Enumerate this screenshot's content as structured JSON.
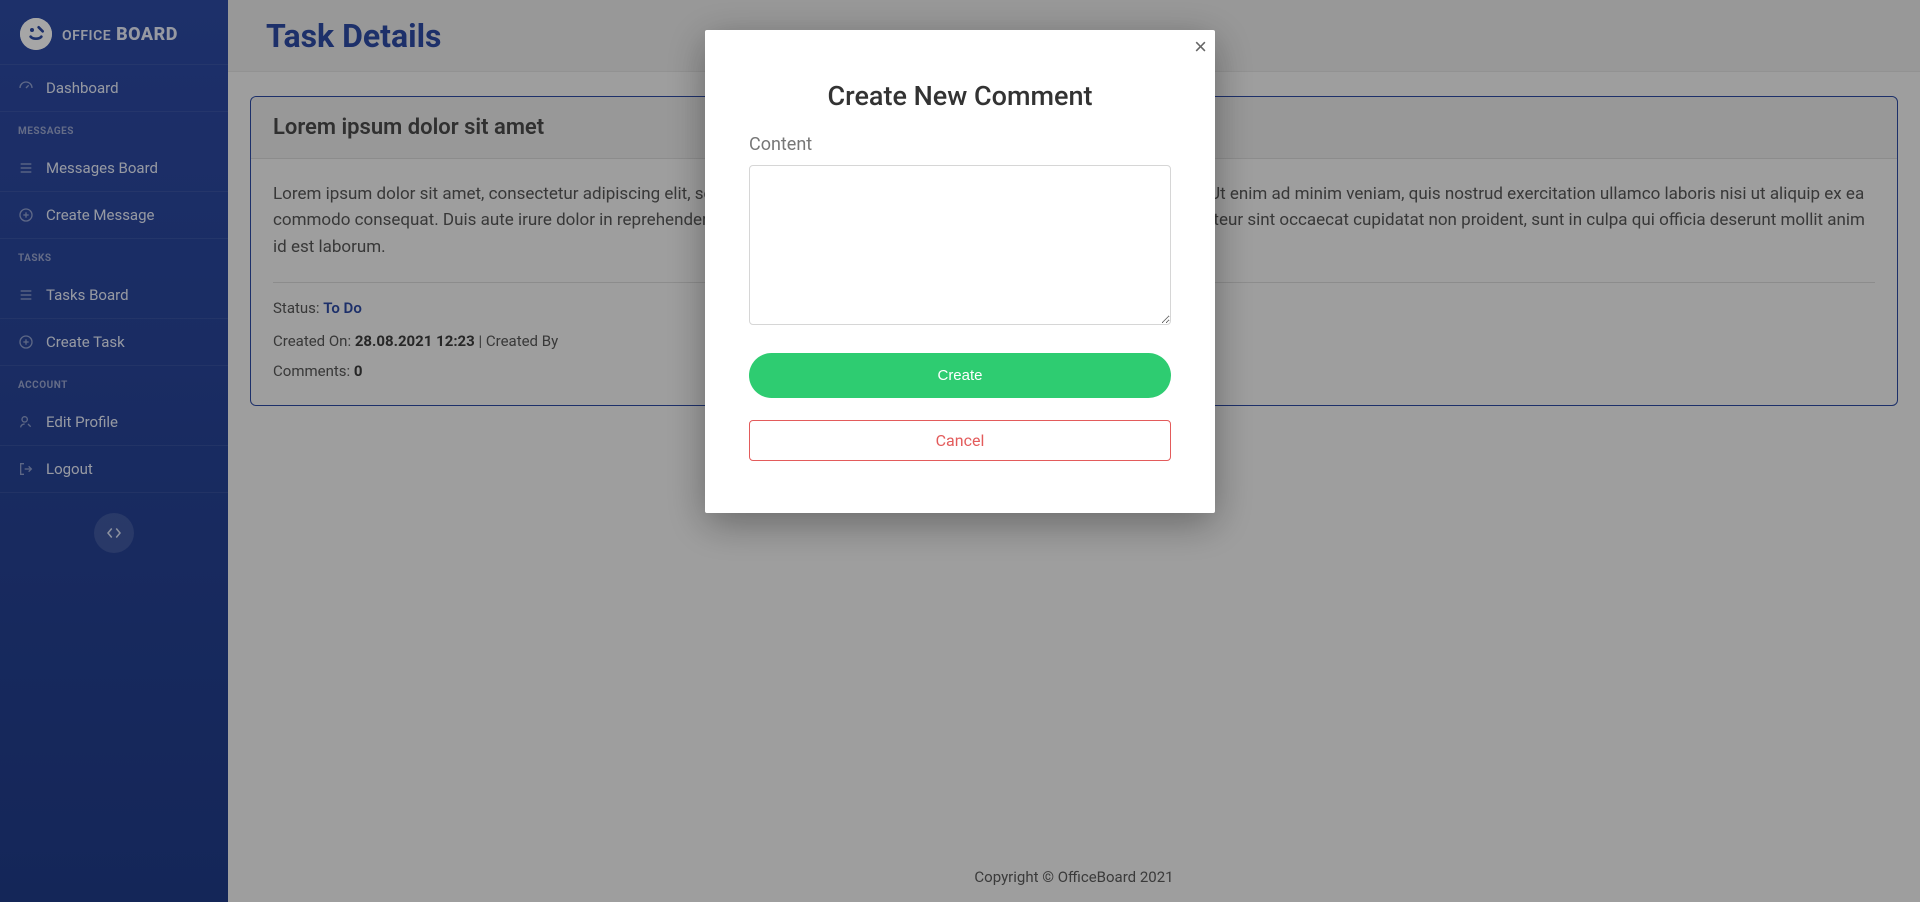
{
  "brand": {
    "prefix": "OFFICE",
    "suffix": " BOARD"
  },
  "sidebar": {
    "dashboard_label": "Dashboard",
    "section_messages": "MESSAGES",
    "messages_board_label": "Messages Board",
    "create_message_label": "Create Message",
    "section_tasks": "TASKS",
    "tasks_board_label": "Tasks Board",
    "create_task_label": "Create Task",
    "section_account": "ACCOUNT",
    "edit_profile_label": "Edit Profile",
    "logout_label": "Logout"
  },
  "page": {
    "title": "Task Details"
  },
  "task": {
    "title": "Lorem ipsum dolor sit amet",
    "description": "Lorem ipsum dolor sit amet, consectetur adipiscing elit, sed do eiusmod tempor incididunt ut labore et dolore magna aliqua. Ut enim ad minim veniam, quis nostrud exercitation ullamco laboris nisi ut aliquip ex ea commodo consequat. Duis aute irure dolor in reprehenderit in voluptate velit esse cillum dolore eu fugiat nulla pariatur. Excepteur sint occaecat cupidatat non proident, sunt in culpa qui officia deserunt mollit anim id est laborum.",
    "status_label": "Status: ",
    "status_value": "To Do",
    "created_on_label": "Created On: ",
    "created_on_value": "28.08.2021 12:23",
    "created_by_label": "Created By",
    "separator": " | ",
    "comments_label": "Comments: ",
    "comments_count": "0"
  },
  "footer": {
    "text": "Copyright © OfficeBoard 2021"
  },
  "modal": {
    "title": "Create New Comment",
    "content_label": "Content",
    "create_button": "Create",
    "cancel_button": "Cancel",
    "close_symbol": "×"
  }
}
